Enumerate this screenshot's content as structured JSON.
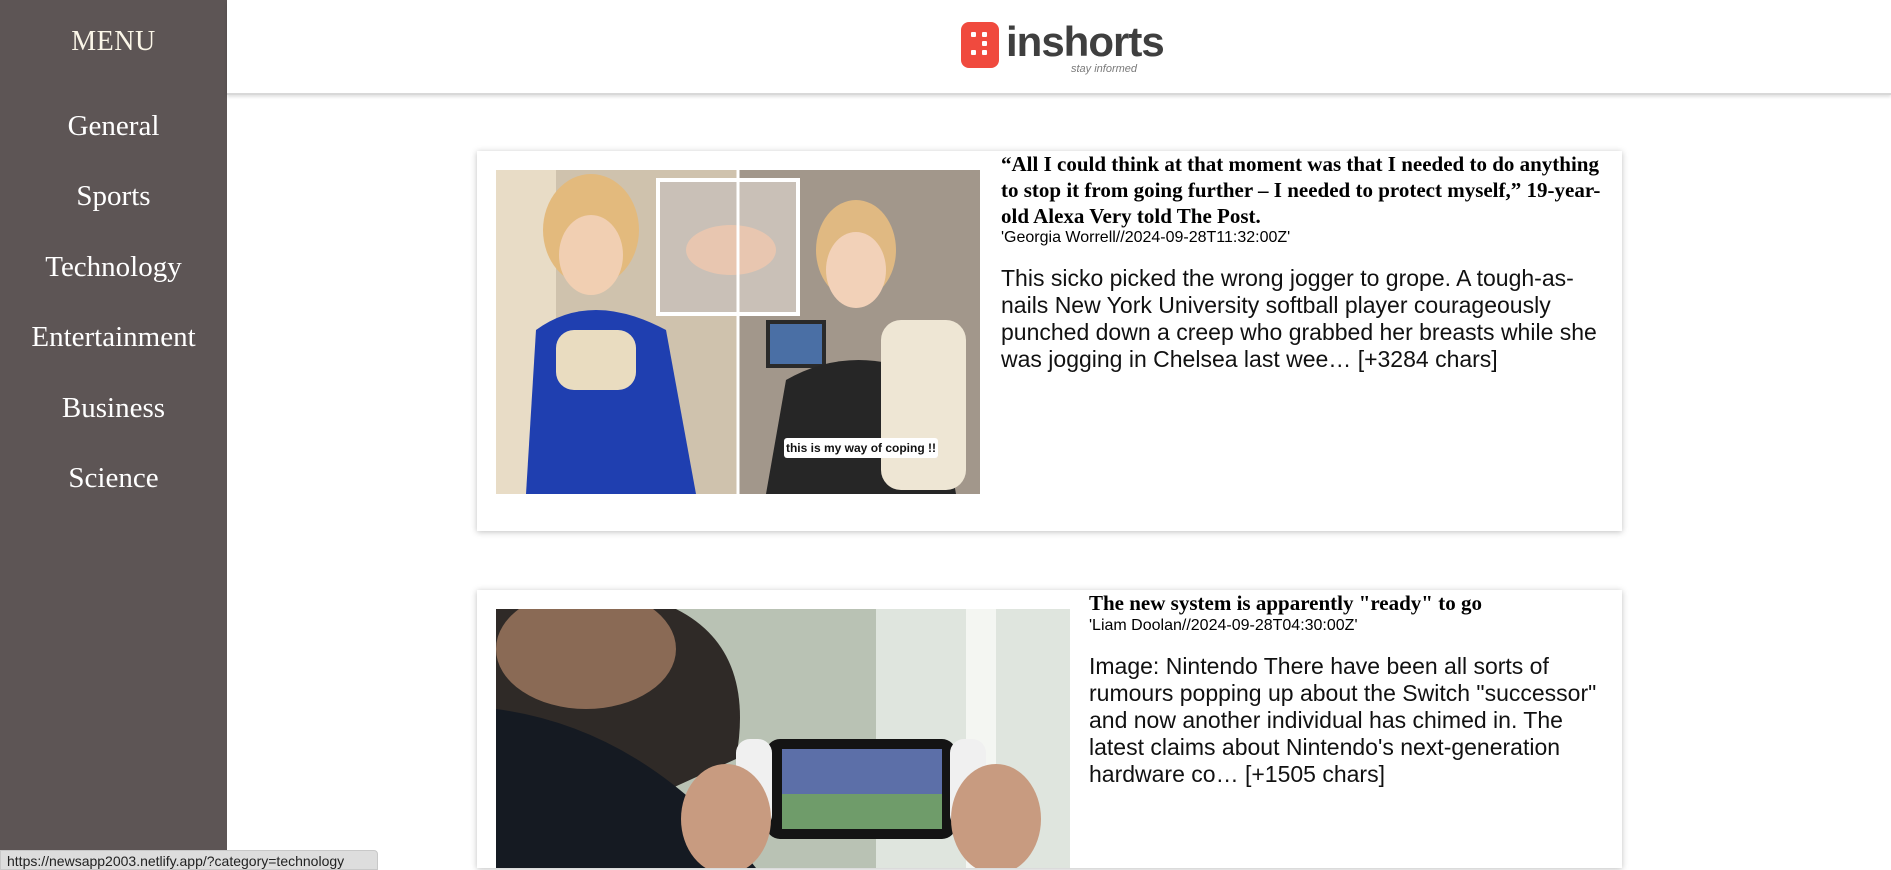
{
  "sidebar": {
    "title": "MENU",
    "items": [
      {
        "label": "General"
      },
      {
        "label": "Sports"
      },
      {
        "label": "Technology"
      },
      {
        "label": "Entertainment"
      },
      {
        "label": "Business"
      },
      {
        "label": "Science"
      }
    ]
  },
  "header": {
    "logo_text": "inshorts",
    "tagline": "stay informed",
    "brand_color": "#f04a3e"
  },
  "articles": [
    {
      "title": "“All I could think at that moment was that I needed to do anything to stop it from going further – I needed to protect myself,” 19-year-old Alexa Very told The Post.",
      "meta": "'Georgia Worrell//2024-09-28T11:32:00Z'",
      "description": "This sicko picked the wrong jogger to grope.  A tough-as-nails New York University softball player courageously punched down a creep who grabbed her breasts while she was jogging in Chelsea last wee… [+3284 chars]",
      "image_caption": "this is my way of coping !!"
    },
    {
      "title": "The new system is apparently \"ready\" to go",
      "meta": "'Liam Doolan//2024-09-28T04:30:00Z'",
      "description": "Image: Nintendo There have been all sorts of rumours popping up about the Switch \"successor\" and now another individual has chimed in. The latest claims about Nintendo's next-generation hardware co… [+1505 chars]"
    }
  ],
  "status_bar": {
    "url": "https://newsapp2003.netlify.app/?category=technology"
  }
}
